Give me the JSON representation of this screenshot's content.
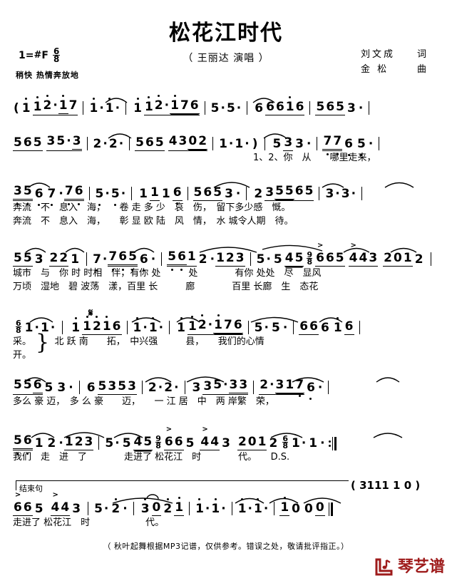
{
  "header": {
    "title": "松花江时代",
    "performer": "（ 王丽达 演唱 ）",
    "key_label": "1=",
    "key_sharp": "#",
    "key_note": "F",
    "meter_num": "6",
    "meter_den": "8",
    "tempo": "稍快 热情奔放地",
    "lyricist_name": "刘文成",
    "lyricist_role": "词",
    "composer_name": "金 松",
    "composer_role": "曲"
  },
  "score": {
    "line1": {
      "notes_text": "( 1 1 2 · 17 | 1 · 1 · | 1 1 2 · 176 | 5 · 5 · | 6 6 616 | 565 3 · |",
      "measures": [
        "1 1 2·17",
        "1·1·",
        "1 1 2·176",
        "5·5·",
        "6 6 616",
        "565 3·"
      ]
    },
    "line2": {
      "notes_text": "565 35·3 | 2 · 2 · | 565 4302 | 1 · 1 · ) | 5 3 3 · | 77 6 5 · |",
      "lyrics": "1、2、你　从　　哪里走来，"
    },
    "line3": {
      "notes_text": "35 6 7 · 76 | 5 · 5 · | 1 1 1 6 | 565 3 · | 2 3 5565 | 3 · 3 · |",
      "lyrics1": "奔流　不　息入　海，　　卷 走 多 少　哀　伤，　留下多少感　慨。",
      "lyrics2": "奔流　不　息入　海，　　彰 显 欧 陆　风　情，　水 城令人期　待。"
    },
    "line4": {
      "notes_text": "55 3 22 1 | 7 · 765 6 · | 561 2 · 123 | 5 · 5 45 | 9/8 665 443 201 2 |",
      "lyrics1": "城市　与　你 时 时相　伴，有你 处　　　处　　　　有你 处处　尽　显风",
      "lyrics2": "万顷　湿地　碧 波荡　漾，百里 长　　　廊　　　　百里 长廊　生　态花",
      "time_change": "9/8"
    },
    "line5": {
      "notes_text": "6/8 1 · 1 · | 1 1 216 | 1 · 1 · | 1 1 2 · 176 | 5 · 5 · | 66 6 1 6 |",
      "lyrics1": "采。　　　北 跃 南　　拓，　中兴强　　　县，　　我们的心情",
      "lyrics2": "开。",
      "time_change": "6/8",
      "segno": "𝄋"
    },
    "line6": {
      "notes_text": "556 5 3 · | 6 5 353 | 2 · 2 · | 3 3 5 · 33 | 2 · 3176 · |",
      "lyrics": "多么 豪 迈，　多 么 豪　　迈，　　一 江 居　中　两 岸繁　荣，"
    },
    "line7": {
      "notes_text": "56 1 2 · 123 | 5 · 5 45 | 9/8 66 5 44 3 201 2 | 6/8 1 · 1 · :|",
      "lyrics": "我们　走　进　了　　　　走进了 松花江　时　　　　代。　　D.S.",
      "time_change_a": "9/8",
      "time_change_b": "6/8",
      "ds": "D.S."
    },
    "line8": {
      "ending_label": "结束句",
      "ossia": "( 3111 1 0 )",
      "notes_text": "66 5 44 3 | 5 · 2 · | 3 0 2 1 | 1 · 1 · | 1 · 1 · | 1 0 00 ‖",
      "lyrics": "走进了 松花江　时　　　　　　代。"
    }
  },
  "footer": {
    "note": "（ 秋叶起舞根据MP3记谱，仅供参考。错误之处，敬请批评指正。）",
    "logo_text": "琴艺谱",
    "logo_color": "#9e1b1b"
  }
}
